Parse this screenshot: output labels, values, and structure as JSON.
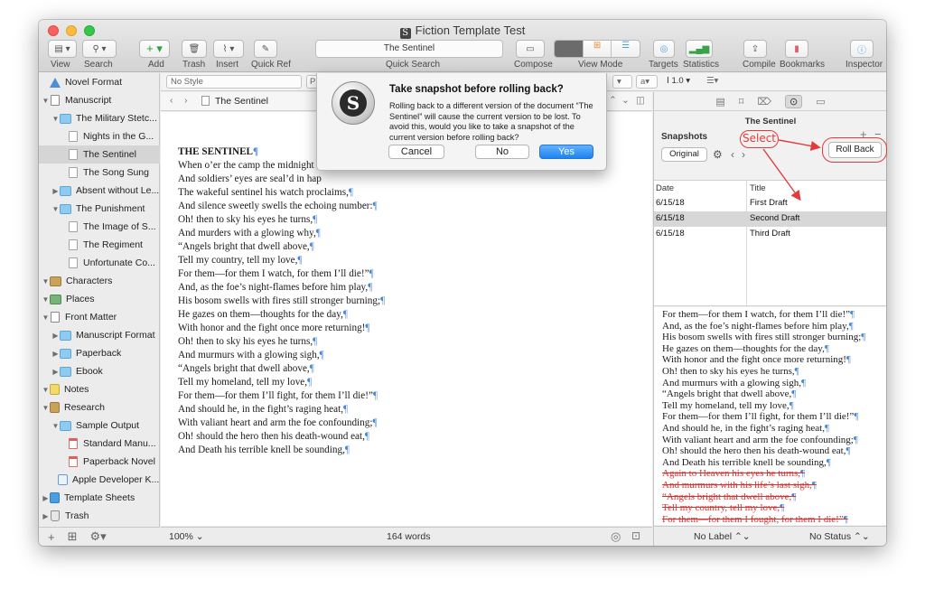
{
  "window": {
    "title": "Fiction Template Test"
  },
  "toolbar": {
    "view": "View",
    "search": "Search",
    "add": "Add",
    "trash": "Trash",
    "insert": "Insert",
    "quick_ref": "Quick Ref",
    "quick_search_value": "The Sentinel",
    "quick_search_label": "Quick Search",
    "compose": "Compose",
    "view_mode": "View Mode",
    "targets": "Targets",
    "statistics": "Statistics",
    "compile": "Compile",
    "bookmarks": "Bookmarks",
    "inspector": "Inspector"
  },
  "binder": {
    "items": [
      {
        "label": "Novel Format"
      },
      {
        "label": "Manuscript"
      },
      {
        "label": "The Military Stetc..."
      },
      {
        "label": "Nights in the G..."
      },
      {
        "label": "The Sentinel"
      },
      {
        "label": "The Song Sung"
      },
      {
        "label": "Absent without Le..."
      },
      {
        "label": "The Punishment"
      },
      {
        "label": "The Image of S..."
      },
      {
        "label": "The Regiment"
      },
      {
        "label": "Unfortunate Co..."
      },
      {
        "label": "Characters"
      },
      {
        "label": "Places"
      },
      {
        "label": "Front Matter"
      },
      {
        "label": "Manuscript Format"
      },
      {
        "label": "Paperback"
      },
      {
        "label": "Ebook"
      },
      {
        "label": "Notes"
      },
      {
        "label": "Research"
      },
      {
        "label": "Sample Output"
      },
      {
        "label": "Standard Manu..."
      },
      {
        "label": "Paperback Novel"
      },
      {
        "label": "Apple Developer K..."
      },
      {
        "label": "Template Sheets"
      },
      {
        "label": "Trash"
      }
    ]
  },
  "format_bar": {
    "style": "No Style",
    "font_partial": "P",
    "spacing": "1.0"
  },
  "editor": {
    "header_title": "The Sentinel",
    "lines": [
      "THE SENTINEL",
      "When o’er the camp the midnight n",
      "And soldiers’ eyes are seal’d in hap",
      "The wakeful sentinel his watch proclaims,",
      "And silence sweetly swells the echoing number:",
      "Oh! then to sky his eyes he turns,",
      "And murders with a glowing why,",
      "“Angels bright that dwell above,",
      "Tell my country, tell my love,",
      "For them—for them I watch, for them I’ll die!”",
      "And, as the foe’s night-flames before him play,",
      "His bosom swells with fires still stronger burning;",
      "He gazes on them—thoughts for the day,",
      "With honor and the fight once more returning!",
      "Oh! then to sky his eyes he turns,",
      "And murmurs with a glowing sigh,",
      "“Angels bright that dwell above,",
      "Tell my homeland, tell my love,",
      "For them—for them I’ll fight, for them I’ll die!”",
      "And should he, in the fight’s raging heat,",
      "With valiant heart and arm the foe confounding;",
      "Oh! should the hero then his death-wound eat,",
      "And Death his terrible knell be sounding,"
    ],
    "zoom": "100%",
    "word_count": "164 words"
  },
  "inspector": {
    "doc_title": "The Sentinel",
    "snapshots_label": "Snapshots",
    "original_btn": "Original",
    "roll_back": "Roll Back",
    "annotation_select": "Select",
    "col_date": "Date",
    "col_title": "Title",
    "rows": [
      {
        "date": "6/15/18",
        "title": "First Draft"
      },
      {
        "date": "6/15/18",
        "title": "Second Draft"
      },
      {
        "date": "6/15/18",
        "title": "Third Draft"
      }
    ],
    "snapshot_lines": [
      {
        "text": "For them—for them I watch, for them I’ll die!”",
        "del": false
      },
      {
        "text": "And, as the foe’s night-flames before him play,",
        "del": false
      },
      {
        "text": "His bosom swells with fires still stronger burning;",
        "del": false
      },
      {
        "text": "He gazes on them—thoughts for the day,",
        "del": false
      },
      {
        "text": "With honor and the fight once more returning!",
        "del": false
      },
      {
        "text": "Oh! then to sky his eyes he turns,",
        "del": false
      },
      {
        "text": "And murmurs with a glowing sigh,",
        "del": false
      },
      {
        "text": "“Angels bright that dwell above,",
        "del": false
      },
      {
        "text": "Tell my homeland, tell my love,",
        "del": false
      },
      {
        "text": "For them—for them I’ll fight, for them I’ll die!”",
        "del": false
      },
      {
        "text": "And should he, in the fight’s raging heat,",
        "del": false
      },
      {
        "text": "With valiant heart and arm the foe confounding;",
        "del": false
      },
      {
        "text": "Oh! should the hero then his death-wound eat,",
        "del": false
      },
      {
        "text": "And Death his terrible knell be sounding,",
        "del": false
      },
      {
        "text": "Again to Heaven his eyes he turns,",
        "del": true
      },
      {
        "text": "And murmurs with his life’s last sigh,",
        "del": true
      },
      {
        "text": "“Angels bright that dwell above,",
        "del": true
      },
      {
        "text": "Tell my country, tell my love,",
        "del": true
      },
      {
        "text": "For them—for them I fought, for them I die!”",
        "del": true
      }
    ],
    "label": "No Label",
    "status": "No Status"
  },
  "dialog": {
    "title": "Take snapshot before rolling back?",
    "message": "Rolling back to a different version of the document “The Sentinel” will cause the current version to be lost. To avoid this, would you like to take a snapshot of the current version before rolling back?",
    "cancel": "Cancel",
    "no": "No",
    "yes": "Yes"
  },
  "colors": {
    "accent": "#1d83f0",
    "annotation": "#e23b3b",
    "deleted": "#d63434",
    "pilcrow": "#4a86d6"
  }
}
